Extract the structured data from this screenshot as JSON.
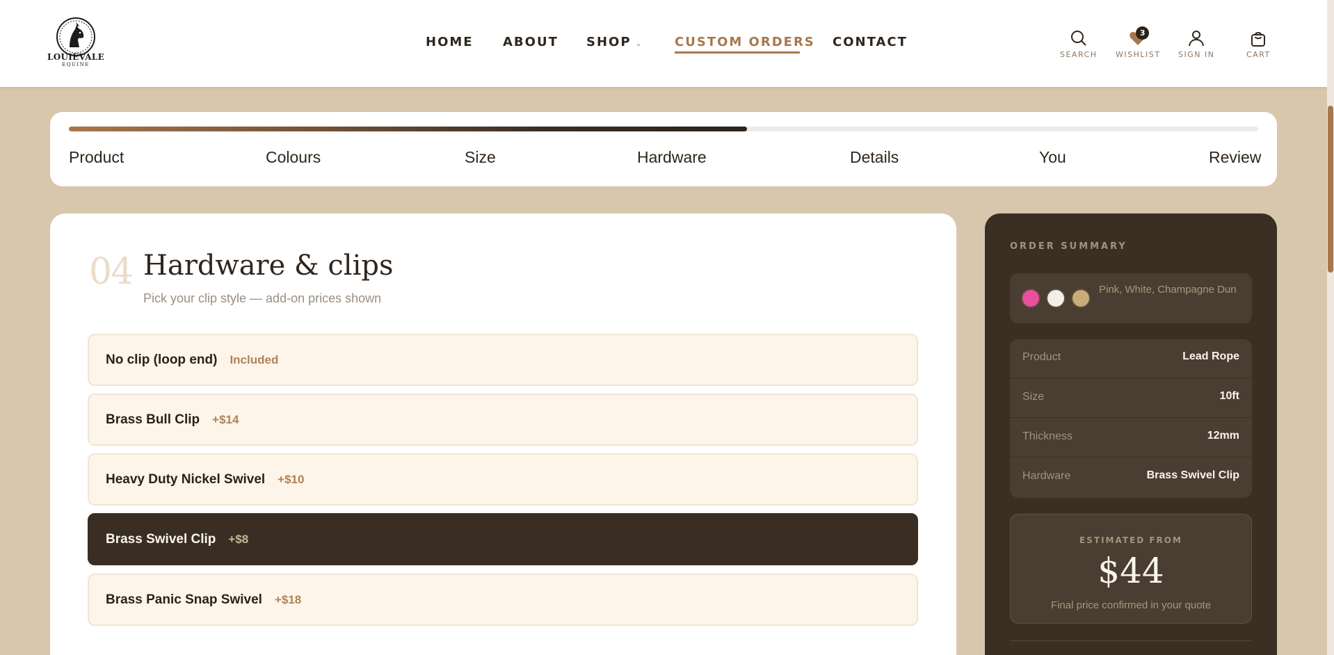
{
  "brand": {
    "name": "LOUIEVALE",
    "sub": "EQUINE"
  },
  "nav": {
    "home": "HOME",
    "about": "ABOUT",
    "shop": "SHOP",
    "custom_orders": "CUSTOM ORDERS",
    "contact": "CONTACT"
  },
  "utility": {
    "search": "SEARCH",
    "wishlist": "WISHLIST",
    "wishlist_count": "3",
    "sign_in": "SIGN IN",
    "cart": "CART"
  },
  "stepper": {
    "progress_percent": 57,
    "steps": [
      "Product",
      "Colours",
      "Size",
      "Hardware",
      "Details",
      "You",
      "Review"
    ]
  },
  "main": {
    "step_number": "04",
    "title": "Hardware & clips",
    "subtitle": "Pick your clip style — add-on prices shown",
    "options": [
      {
        "name": "No clip (loop end)",
        "price": "Included",
        "selected": false
      },
      {
        "name": "Brass Bull Clip",
        "price": "+$14",
        "selected": false
      },
      {
        "name": "Heavy Duty Nickel Swivel",
        "price": "+$10",
        "selected": false
      },
      {
        "name": "Brass Swivel Clip",
        "price": "+$8",
        "selected": true
      },
      {
        "name": "Brass Panic Snap Swivel",
        "price": "+$18",
        "selected": false
      }
    ]
  },
  "summary": {
    "title": "ORDER SUMMARY",
    "colors_text": "Pink, White, Champagne Dun",
    "swatches": [
      "#ea4f9c",
      "#f4efe6",
      "#c8ad7a"
    ],
    "rows": [
      {
        "label": "Product",
        "value": "Lead Rope"
      },
      {
        "label": "Size",
        "value": "10ft"
      },
      {
        "label": "Thickness",
        "value": "12mm"
      },
      {
        "label": "Hardware",
        "value": "Brass Swivel Clip"
      }
    ],
    "estimate_label": "ESTIMATED FROM",
    "estimate_price": "$44",
    "estimate_note": "Final price confirmed in your quote"
  },
  "colors": {
    "accent": "#a8774d",
    "dark": "#3a2e24",
    "background": "#d8c7ad"
  }
}
